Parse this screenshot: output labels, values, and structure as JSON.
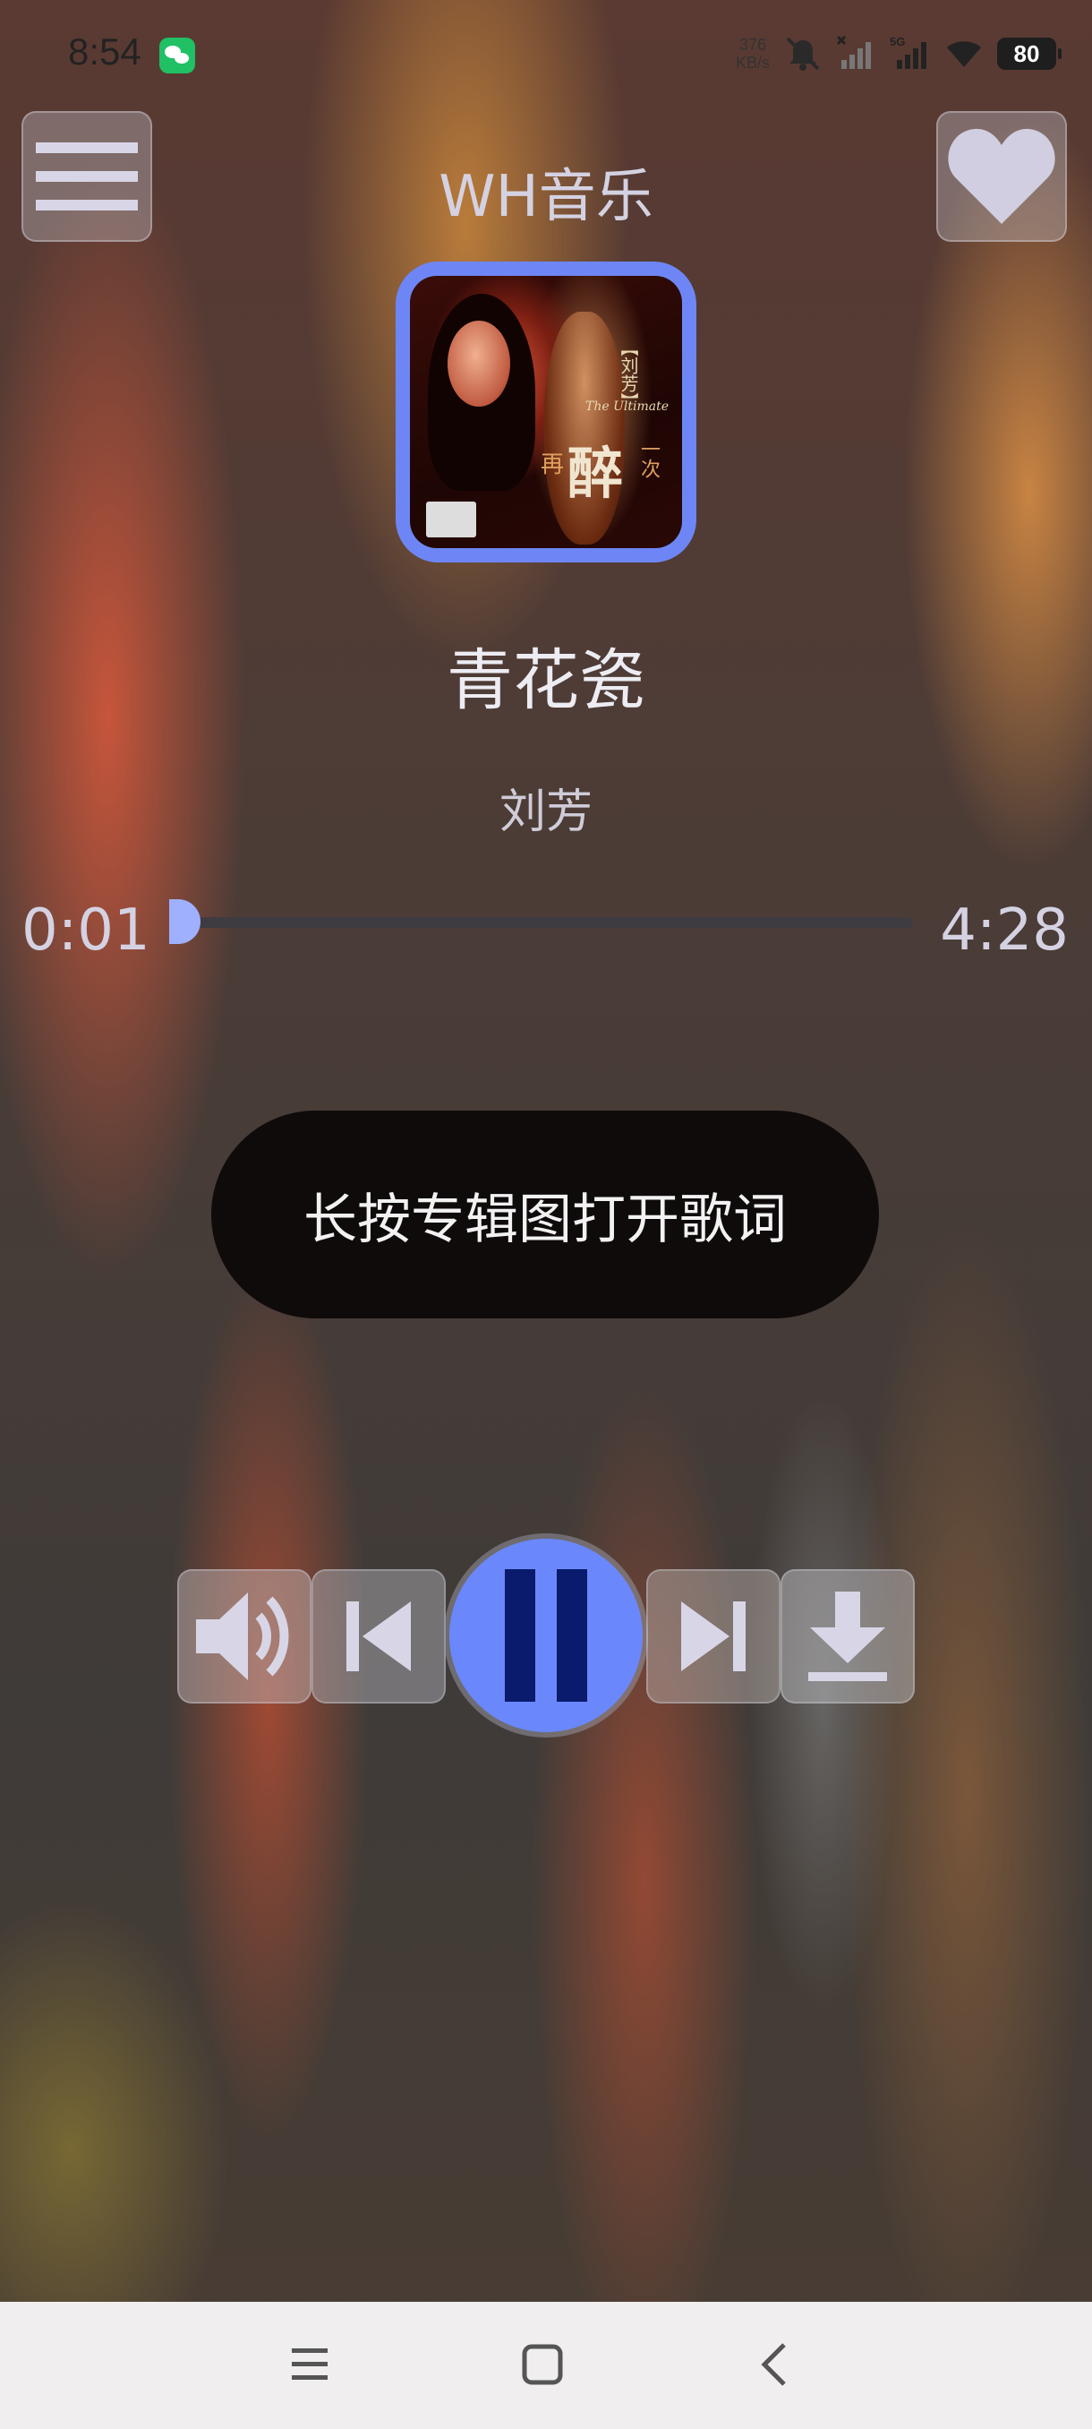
{
  "status_bar": {
    "time": "8:54",
    "net_speed_value": "376",
    "net_speed_unit": "KB/s",
    "network": "5G",
    "battery": "80"
  },
  "header": {
    "title": "WH音乐"
  },
  "song": {
    "title": "青花瓷",
    "artist": "刘芳"
  },
  "album_art": {
    "cover_text_artist": "【刘芳】",
    "cover_text_en": "The Ultimate",
    "cover_text_main": "醉",
    "cover_text_left": "再",
    "cover_text_right": "一次",
    "accent_color": "#6e86f5"
  },
  "player": {
    "current_time": "0:01",
    "total_time": "4:28",
    "progress_fraction": 0.004
  },
  "toast": {
    "message": "长按专辑图打开歌词"
  },
  "controls": {
    "play_button_color": "#6a88fb",
    "pause_icon_color": "#0a1b6e",
    "icons": [
      "volume-icon",
      "skip-previous-icon",
      "pause-icon",
      "skip-next-icon",
      "download-icon"
    ]
  },
  "nav_bar": {
    "icons": [
      "menu-icon",
      "home-icon",
      "back-icon"
    ]
  }
}
